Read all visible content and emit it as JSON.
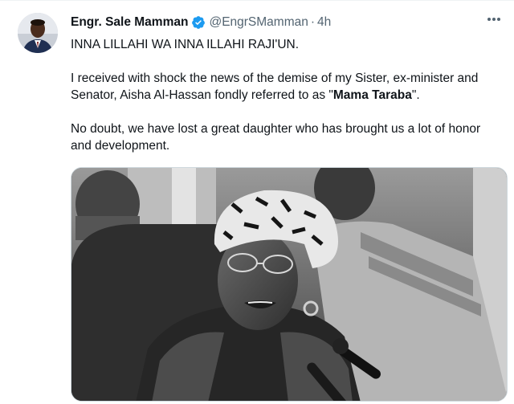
{
  "tweet": {
    "author": {
      "name": "Engr. Sale Mamman",
      "handle": "@EngrSMamman",
      "separator": "·",
      "time": "4h",
      "verified": true,
      "avatar_icon": "user-avatar"
    },
    "more_icon": "more-dots-icon",
    "paragraphs": {
      "p1": "INNA LILLAHI WA INNA ILLAHI RAJI'UN.",
      "p2_before": "I received with shock the news of the demise of my Sister, ex-minister and Senator, Aisha Al-Hassan fondly referred to as \"",
      "p2_bold": "Mama Taraba",
      "p2_after": "\".",
      "p3": "No doubt, we have lost a great daughter who has brought us a lot of honor and development."
    },
    "media": {
      "kind": "photo",
      "style": "black-and-white"
    },
    "colors": {
      "verified_blue": "#1d9bf0",
      "secondary_text": "#536471",
      "primary_text": "#0f1419"
    }
  }
}
